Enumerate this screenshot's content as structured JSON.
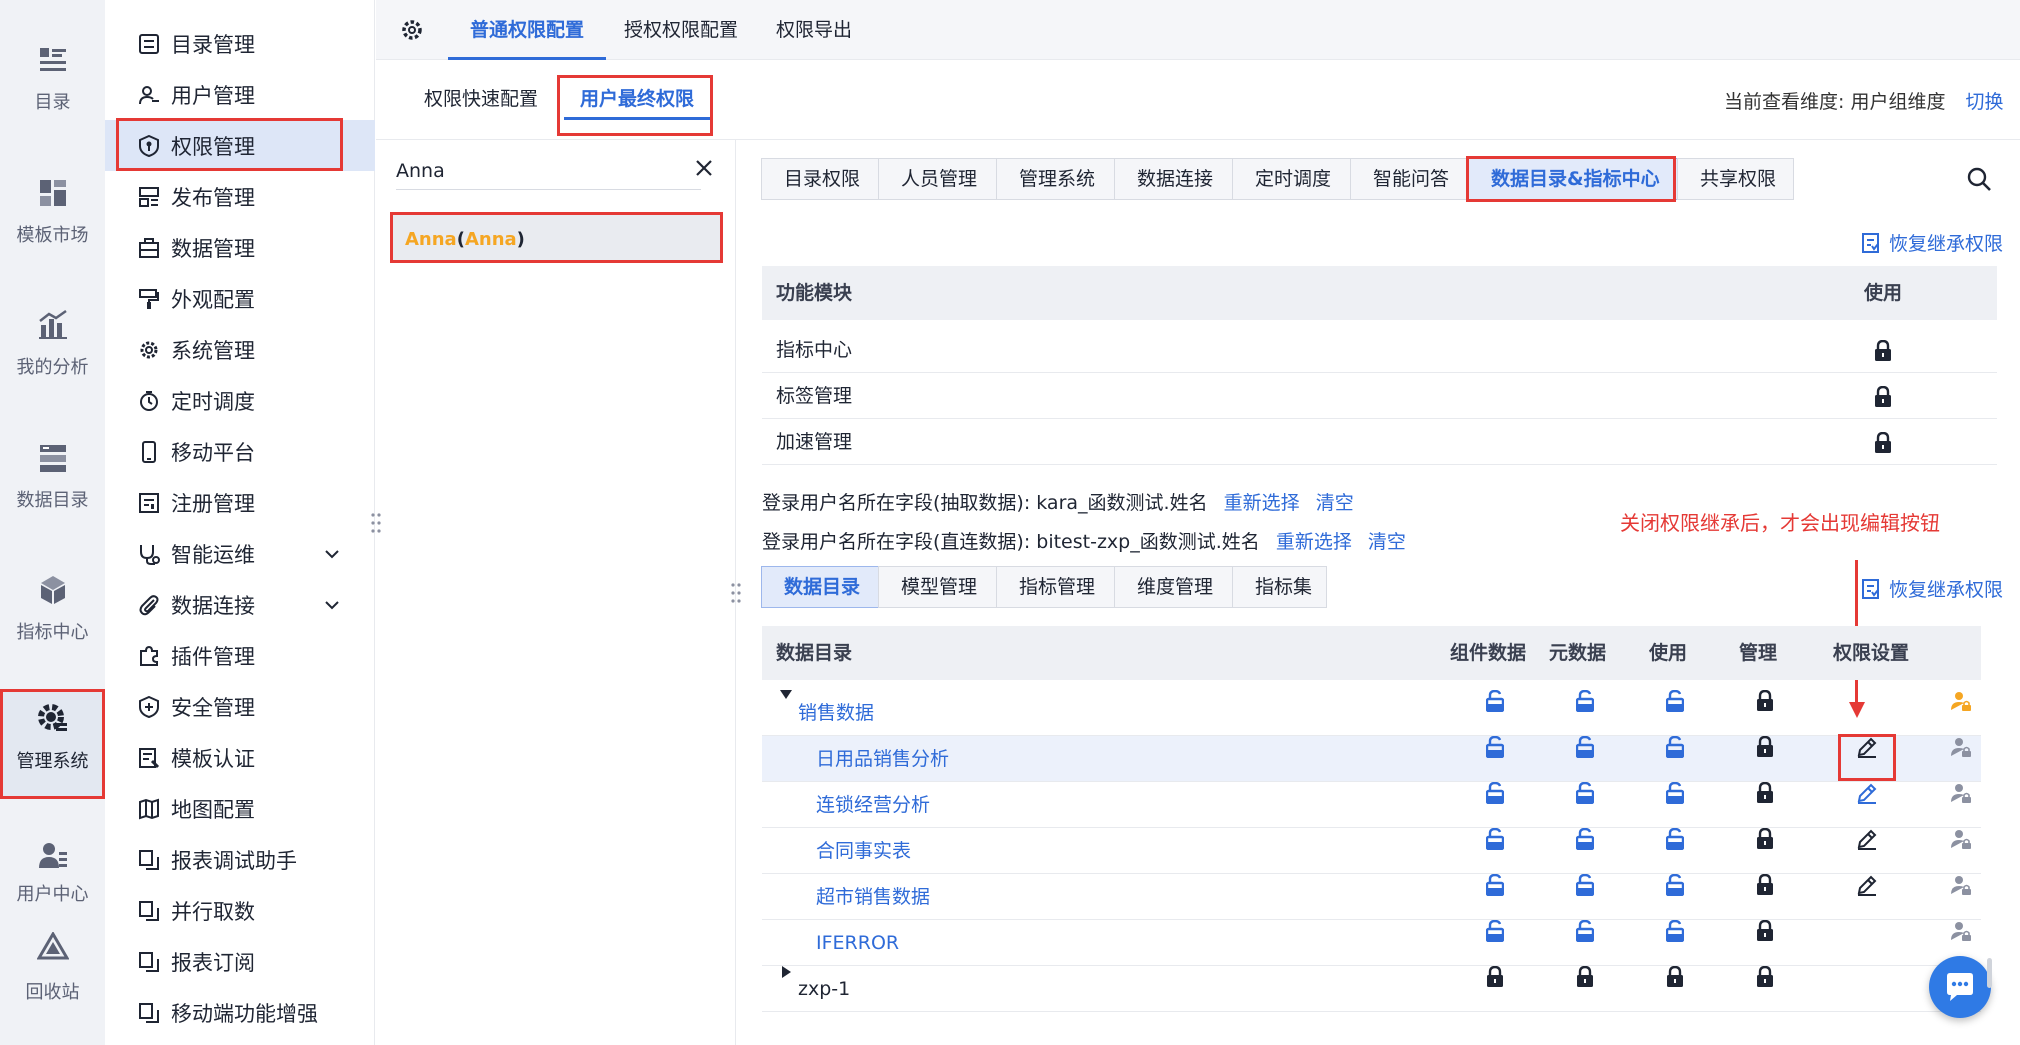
{
  "rail": [
    {
      "label": "目录",
      "icon": "list-icon"
    },
    {
      "label": "模板市场",
      "icon": "grid-icon"
    },
    {
      "label": "我的分析",
      "icon": "chart-icon"
    },
    {
      "label": "数据目录",
      "icon": "database-icon"
    },
    {
      "label": "指标中心",
      "icon": "cube-icon"
    },
    {
      "label": "管理系统",
      "icon": "gear-icon",
      "active": true
    },
    {
      "label": "用户中心",
      "icon": "user-icon"
    },
    {
      "label": "回收站",
      "icon": "trash-icon"
    }
  ],
  "menu": [
    {
      "label": "目录管理",
      "icon": "list-icon"
    },
    {
      "label": "用户管理",
      "icon": "user-icon"
    },
    {
      "label": "权限管理",
      "icon": "shield-icon",
      "active": true
    },
    {
      "label": "发布管理",
      "icon": "publish-icon"
    },
    {
      "label": "数据管理",
      "icon": "briefcase-icon"
    },
    {
      "label": "外观配置",
      "icon": "brush-icon"
    },
    {
      "label": "系统管理",
      "icon": "gear-icon"
    },
    {
      "label": "定时调度",
      "icon": "timer-icon"
    },
    {
      "label": "移动平台",
      "icon": "mobile-icon"
    },
    {
      "label": "注册管理",
      "icon": "register-icon"
    },
    {
      "label": "智能运维",
      "icon": "stethoscope-icon",
      "expandable": true
    },
    {
      "label": "数据连接",
      "icon": "clip-icon",
      "expandable": true
    },
    {
      "label": "插件管理",
      "icon": "puzzle-icon"
    },
    {
      "label": "安全管理",
      "icon": "shield-plus-icon"
    },
    {
      "label": "模板认证",
      "icon": "cert-icon"
    },
    {
      "label": "地图配置",
      "icon": "map-icon"
    },
    {
      "label": "报表调试助手",
      "icon": "copy-icon"
    },
    {
      "label": "并行取数",
      "icon": "copy-icon"
    },
    {
      "label": "报表订阅",
      "icon": "copy-icon"
    },
    {
      "label": "移动端功能增强",
      "icon": "copy-icon"
    }
  ],
  "top_tabs": [
    "普通权限配置",
    "授权权限配置",
    "权限导出"
  ],
  "sub_tabs": [
    "权限快速配置",
    "用户最终权限"
  ],
  "dimension": {
    "label": "当前查看维度:",
    "value": "用户组维度",
    "switch": "切换"
  },
  "search": {
    "value": "Anna"
  },
  "user": {
    "name": "Anna",
    "open": " (",
    "id": "Anna",
    "close": ")"
  },
  "category_tabs": [
    "目录权限",
    "人员管理",
    "管理系统",
    "数据连接",
    "定时调度",
    "智能问答",
    "数据目录&指标中心",
    "共享权限"
  ],
  "restore_label": "恢复继承权限",
  "func_table": {
    "headers": [
      "功能模块",
      "使用"
    ],
    "rows": [
      "指标中心",
      "标签管理",
      "加速管理"
    ]
  },
  "field_lines": [
    {
      "text": "登录用户名所在字段(抽取数据): kara_函数测试.姓名",
      "reselect": "重新选择",
      "clear": "清空"
    },
    {
      "text": "登录用户名所在字段(直连数据): bitest-zxp_函数测试.姓名",
      "reselect": "重新选择",
      "clear": "清空"
    }
  ],
  "annotation": "关闭权限继承后，才会出现编辑按钮",
  "data_tabs": [
    "数据目录",
    "模型管理",
    "指标管理",
    "维度管理",
    "指标集"
  ],
  "data_table": {
    "headers": [
      "数据目录",
      "组件数据",
      "元数据",
      "使用",
      "管理",
      "权限设置"
    ],
    "rows": [
      {
        "name": "销售数据",
        "level": 0,
        "expanded": true,
        "locks": [
          "open",
          "open",
          "open",
          "closed"
        ],
        "edit": "none",
        "user": "yellow"
      },
      {
        "name": "日用品销售分析",
        "level": 1,
        "locks": [
          "open",
          "open",
          "open",
          "closed"
        ],
        "edit": "dark",
        "user": "gray",
        "selected": true
      },
      {
        "name": "连锁经营分析",
        "level": 1,
        "locks": [
          "open",
          "open",
          "open",
          "closed"
        ],
        "edit": "blue",
        "user": "gray"
      },
      {
        "name": "合同事实表",
        "level": 1,
        "locks": [
          "open",
          "open",
          "open",
          "closed"
        ],
        "edit": "dark",
        "user": "gray"
      },
      {
        "name": "超市销售数据",
        "level": 1,
        "locks": [
          "open",
          "open",
          "open",
          "closed"
        ],
        "edit": "dark",
        "user": "gray"
      },
      {
        "name": "IFERROR",
        "level": 1,
        "locks": [
          "open",
          "open",
          "open",
          "closed"
        ],
        "edit": "none",
        "user": "gray"
      },
      {
        "name": "zxp-1",
        "level": 0,
        "expanded": false,
        "locks": [
          "closed",
          "closed",
          "closed",
          "closed"
        ],
        "edit": "none",
        "user": "none"
      }
    ]
  },
  "colors": {
    "accent": "#2f6bd8",
    "highlight": "#e53935",
    "orange": "#f5a623"
  }
}
